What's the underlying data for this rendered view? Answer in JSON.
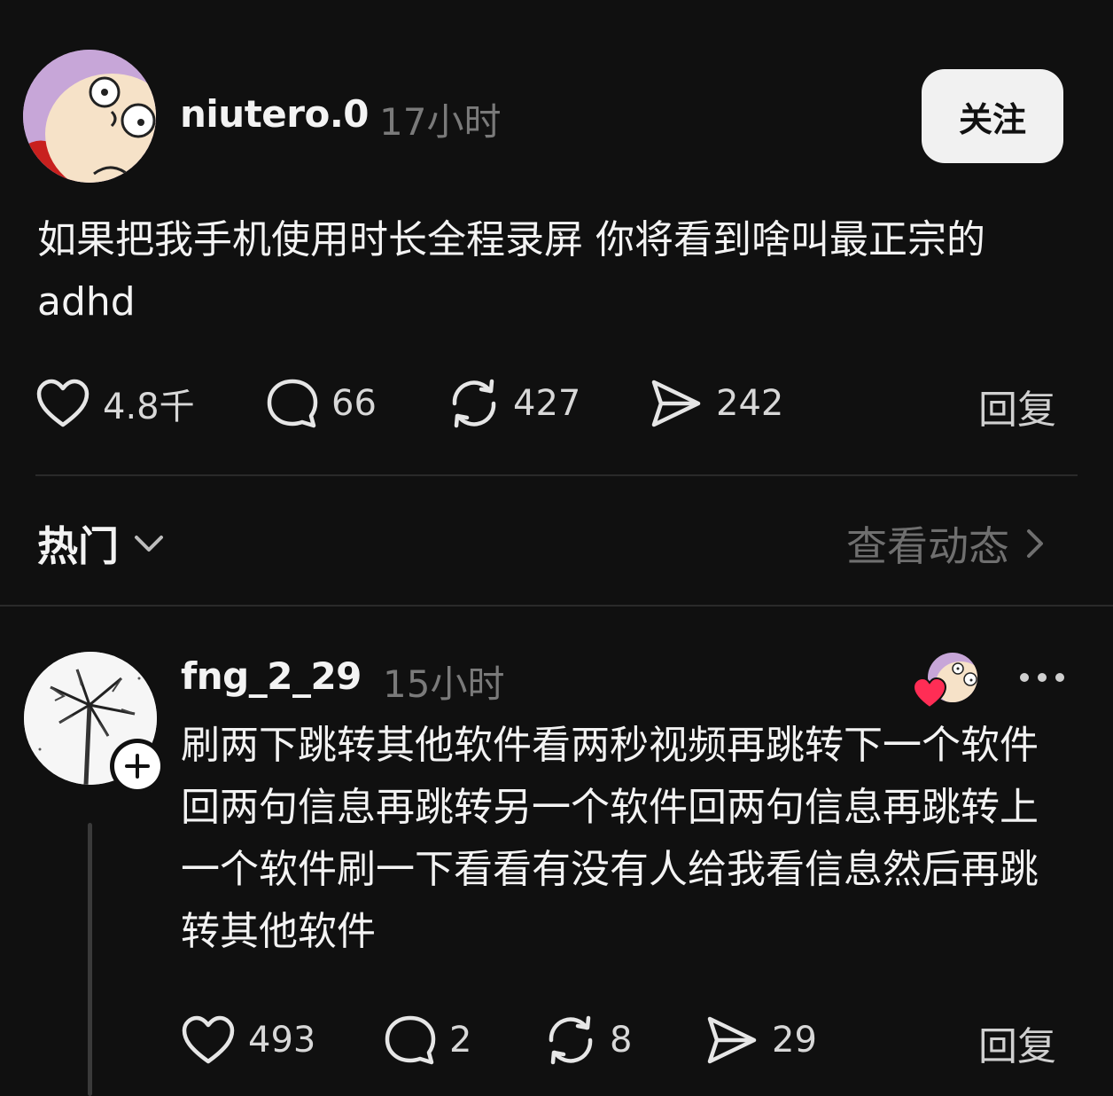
{
  "post": {
    "author": "niutero.0",
    "time": "17小时",
    "follow_label": "关注",
    "text": "如果把我手机使用时长全程录屏 你将看到啥叫最正宗的adhd",
    "likes": "4.8千",
    "comments": "66",
    "reposts": "427",
    "shares": "242",
    "reply_label": "回复"
  },
  "filter_bar": {
    "sort_label": "热门",
    "activity_label": "查看动态"
  },
  "reply": {
    "author": "fng_2_29",
    "time": "15小时",
    "text": "刷两下跳转其他软件看两秒视频再跳转下一个软件回两句信息再跳转另一个软件回两句信息再跳转上一个软件刷一下看看有没有人给我看信息然后再跳转其他软件",
    "likes": "493",
    "comments": "2",
    "reposts": "8",
    "shares": "29",
    "reply_label": "回复"
  },
  "colors": {
    "background": "#101010",
    "text": "#f3f3f3",
    "muted": "#7a7a7a",
    "heart": "#ff2d55"
  }
}
